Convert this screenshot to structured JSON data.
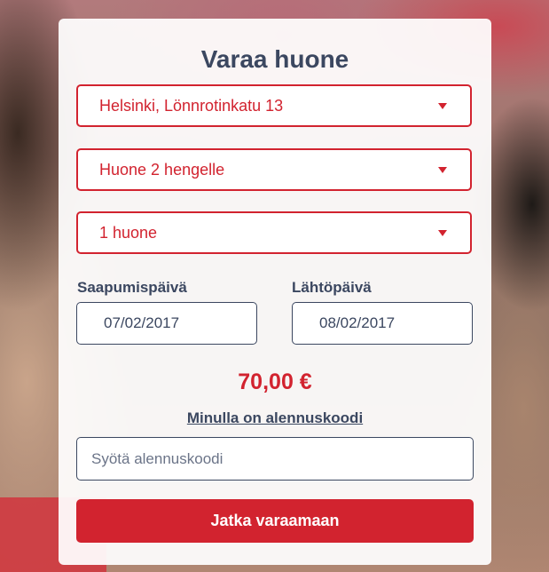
{
  "form": {
    "title": "Varaa huone",
    "location_select": {
      "value": "Helsinki, Lönnrotinkatu 13"
    },
    "room_type_select": {
      "value": "Huone 2 hengelle"
    },
    "room_count_select": {
      "value": "1 huone"
    },
    "arrival": {
      "label": "Saapumispäivä",
      "value": "07/02/2017"
    },
    "departure": {
      "label": "Lähtöpäivä",
      "value": "08/02/2017"
    },
    "price": "70,00 €",
    "discount_link": "Minulla on alennuskoodi",
    "discount_input": {
      "value": "",
      "placeholder": "Syötä alennuskoodi"
    },
    "submit_label": "Jatka varaamaan"
  },
  "colors": {
    "accent": "#d2232f",
    "text": "#3b4760",
    "card": "#ffffff"
  },
  "icons": {
    "select_caret": "caret-down-icon"
  }
}
